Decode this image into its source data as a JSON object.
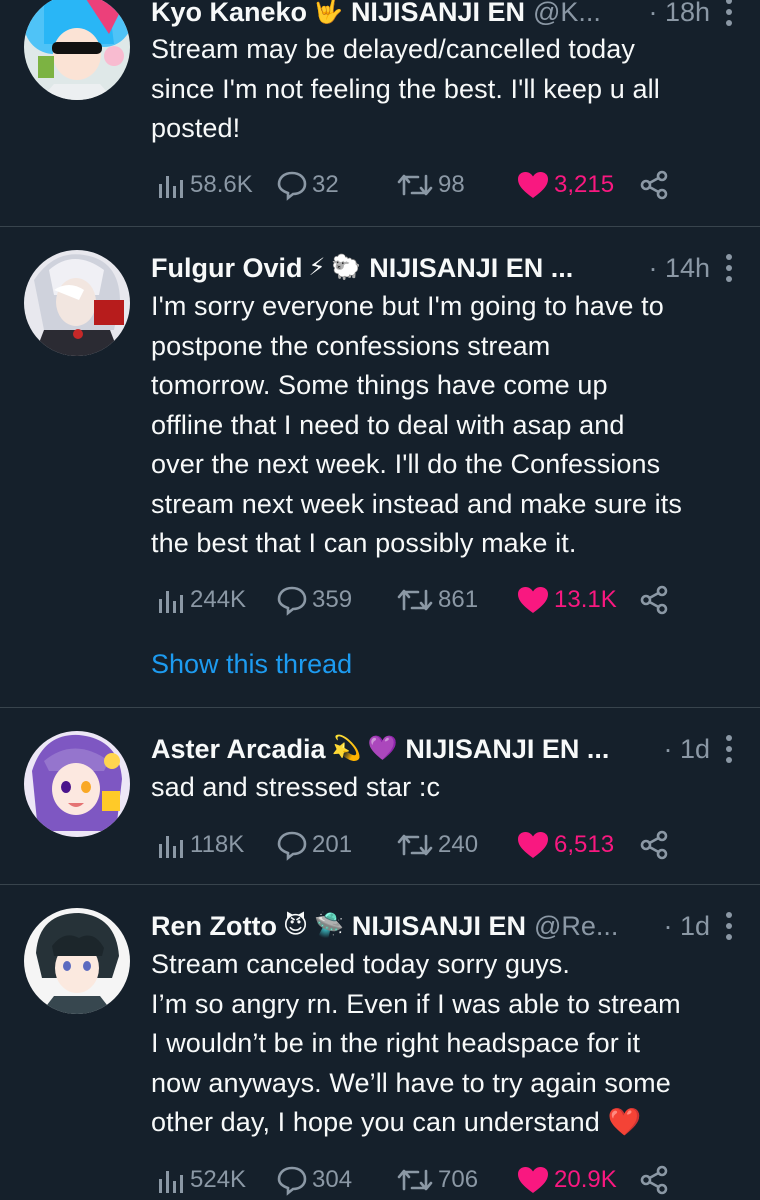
{
  "colors": {
    "background": "#15202b",
    "text": "#f7f9f9",
    "muted": "#8b98a5",
    "like": "#f91880",
    "link": "#1d9bf0",
    "divider": "#38444d"
  },
  "tweets": [
    {
      "name": "Kyo Kaneko",
      "emojis": [
        "🤟"
      ],
      "affiliation": "NIJISANJI EN",
      "handle": "@K...",
      "time": "· 18h",
      "text": "Stream may be delayed/cancelled today\nsince I'm not feeling the best. I'll keep u all\nposted!",
      "views": "58.6K",
      "replies": "32",
      "retweets": "98",
      "likes": "3,215"
    },
    {
      "name": "Fulgur Ovid",
      "emojis": [
        "⚡",
        "🐑"
      ],
      "affiliation": "NIJISANJI EN ...",
      "handle": "",
      "time": "· 14h",
      "text": "I'm sorry everyone but I'm going to have to\npostpone the confessions stream\ntomorrow. Some things have come up\noffline that I need to deal with asap and\nover the next week. I'll do the Confessions\nstream next week instead and make sure its\nthe best that I can possibly make it.",
      "views": "244K",
      "replies": "359",
      "retweets": "861",
      "likes": "13.1K",
      "thread_link": "Show this thread"
    },
    {
      "name": "Aster Arcadia",
      "emojis": [
        "💫",
        "💜"
      ],
      "affiliation": "NIJISANJI EN ...",
      "handle": "",
      "time": "· 1d",
      "text": "sad and stressed star :c",
      "views": "118K",
      "replies": "201",
      "retweets": "240",
      "likes": "6,513"
    },
    {
      "name": "Ren Zotto",
      "emojis": [
        "😈",
        "🛸"
      ],
      "affiliation": "NIJISANJI EN",
      "handle": "@Re...",
      "time": "· 1d",
      "text": "Stream canceled today sorry guys.\nI’m so angry rn. Even if I was able to stream\nI wouldn’t be in the right headspace for it\nnow anyways. We’ll have to try again some\nother day, I hope you can understand ❤️",
      "views": "524K",
      "replies": "304",
      "retweets": "706",
      "likes": "20.9K"
    }
  ]
}
